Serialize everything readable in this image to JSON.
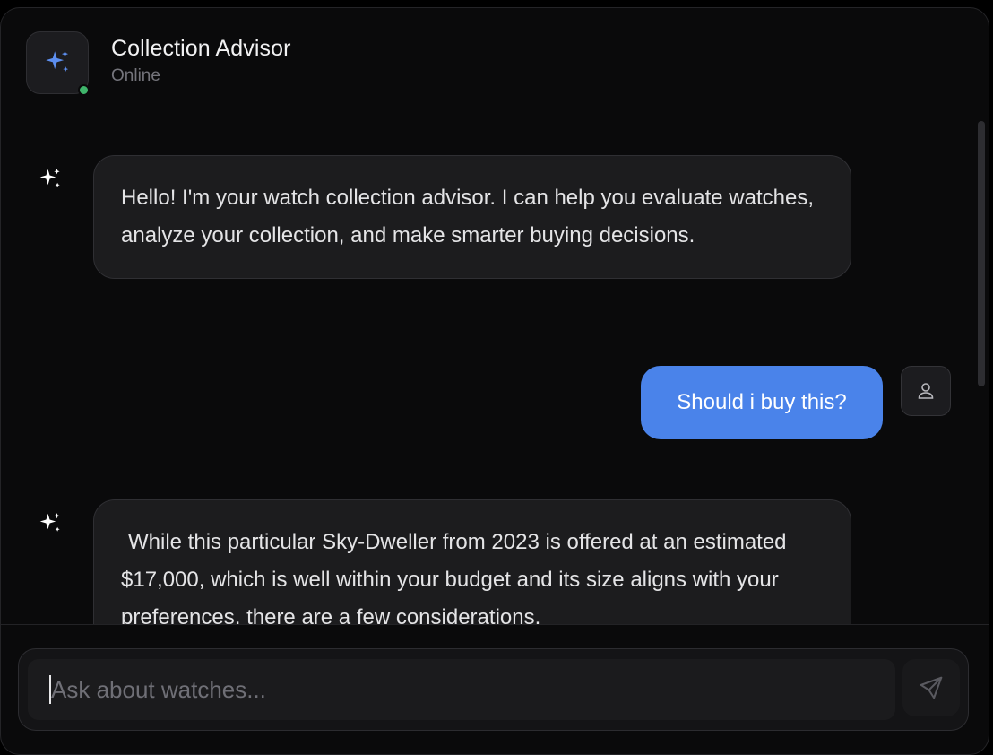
{
  "header": {
    "title": "Collection Advisor",
    "status": "Online",
    "avatar_icon": "sparkles-icon",
    "status_color": "#3fb56b"
  },
  "messages": [
    {
      "role": "assistant",
      "icon": "sparkles-icon",
      "text": "Hello! I'm your watch collection advisor. I can help you evaluate watches, analyze your collection, and make smarter buying decisions."
    },
    {
      "role": "user",
      "icon": "user-icon",
      "text": "Should i buy this?"
    },
    {
      "role": "assistant",
      "icon": "sparkles-icon",
      "text": "While this particular Sky-Dweller from 2023 is offered at an estimated $17,000, which is well within your budget and its size aligns with your preferences, there are a few considerations."
    }
  ],
  "composer": {
    "placeholder": "Ask about watches...",
    "value": "",
    "send_icon": "send-icon"
  },
  "colors": {
    "accent": "#4a83ea",
    "background": "#0a0a0b",
    "bubble": "#1c1c1e"
  }
}
